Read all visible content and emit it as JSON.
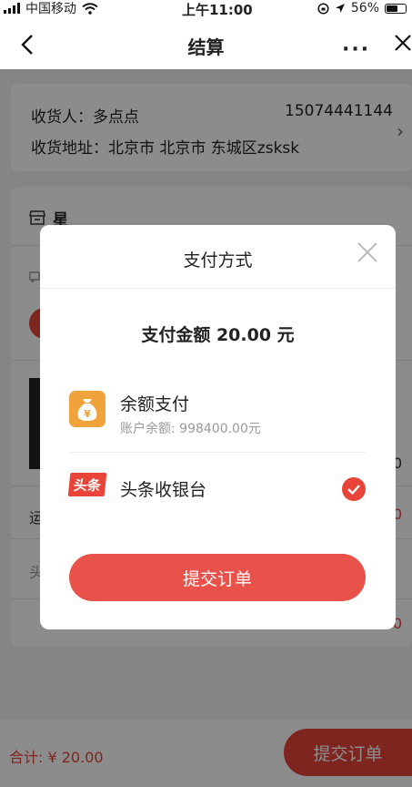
{
  "status_bar": {
    "carrier": "中国移动",
    "time": "上午11:00",
    "battery": "56%",
    "battery_level": 0.56
  },
  "nav": {
    "title": "结算"
  },
  "address": {
    "receiver_label": "收货人：",
    "receiver_name": "多点点",
    "phone": "15074441144",
    "address_label": "收货地址：",
    "address_value": "北京市 北京市 东城区zsksk"
  },
  "store": {
    "name_visible": "星",
    "row_freight_partial": "运",
    "row_toutiao_partial": "头",
    "amount_partial_0": "0",
    "amount_partial_1": "0",
    "amount_partial_2": "0"
  },
  "bottom_bar": {
    "total_label": "合计: ¥ 20.00",
    "submit_label": "提交订单"
  },
  "modal": {
    "title": "支付方式",
    "amount_text": "支付金额 20.00 元",
    "options": [
      {
        "title": "余额支付",
        "subtitle": "账户余额: 998400.00元",
        "icon": "money-bag-icon",
        "selected": false
      },
      {
        "title": "头条收银台",
        "logo_text": "头条",
        "icon": "toutiao-logo-icon",
        "selected": true
      }
    ],
    "submit_label": "提交订单"
  },
  "colors": {
    "accent": "#e8443a",
    "balance_icon": "#f0a33a"
  }
}
